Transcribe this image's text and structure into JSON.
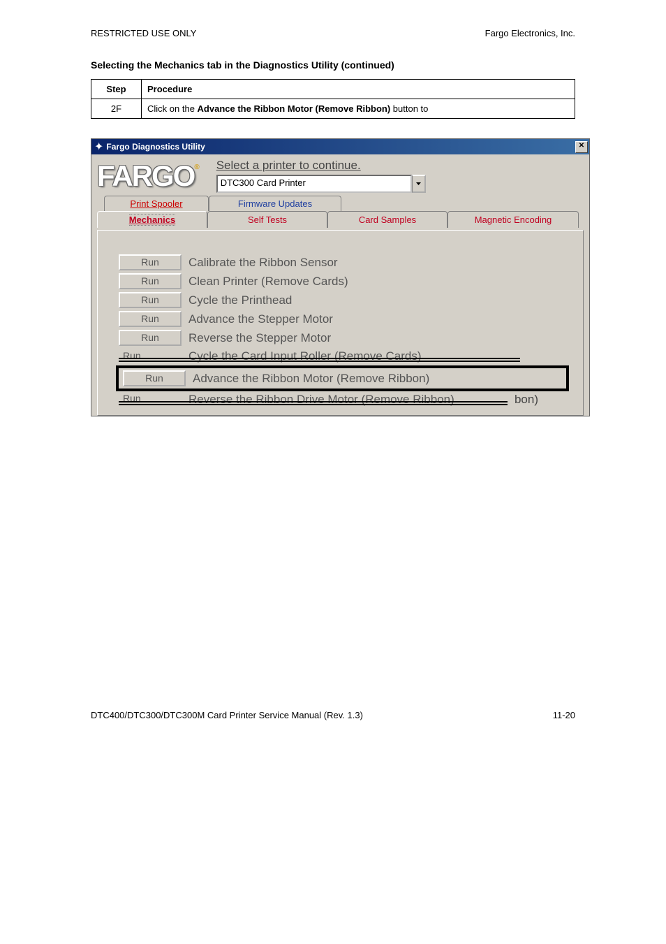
{
  "doc": {
    "restricted": "RESTRICTED USE ONLY",
    "company": "Fargo Electronics, Inc.",
    "heading": "Selecting the Mechanics tab in the Diagnostics Utility (continued)",
    "step_header": "Step",
    "proc_header": "Procedure",
    "step_val": "2F",
    "proc_prefix": "Click on the ",
    "proc_bold": "Advance the Ribbon Motor (Remove Ribbon)",
    "proc_suffix": " button to",
    "footer_left": "DTC400/DTC300/DTC300M Card Printer Service Manual (Rev. 1.3)",
    "footer_right": "11-20"
  },
  "window": {
    "title": "Fargo Diagnostics Utility",
    "logo": "FARGO",
    "select_caption": "Select a printer to continue.",
    "printer": "DTC300 Card Printer",
    "tabs": {
      "spooler": "Print Spooler",
      "firmware": "Firmware Updates",
      "mechanics": "Mechanics",
      "self_tests": "Self Tests",
      "card_samples": "Card Samples",
      "magnetic": "Magnetic Encoding"
    },
    "buttons": {
      "run": "Run"
    },
    "actions": {
      "calibrate": "Calibrate the Ribbon Sensor",
      "clean": "Clean Printer (Remove Cards)",
      "cycle_head": "Cycle the Printhead",
      "adv_stepper": "Advance the Stepper Motor",
      "rev_stepper": "Reverse the Stepper Motor",
      "cycle_card": "Cycle the Card Input Roller (Remove Cards)",
      "adv_ribbon": "Advance the Ribbon Motor (Remove Ribbon)",
      "rev_ribbon": "Reverse the Ribbon Drive Motor (Remove Ribbon)",
      "ribbon_tail": "bon)"
    }
  }
}
